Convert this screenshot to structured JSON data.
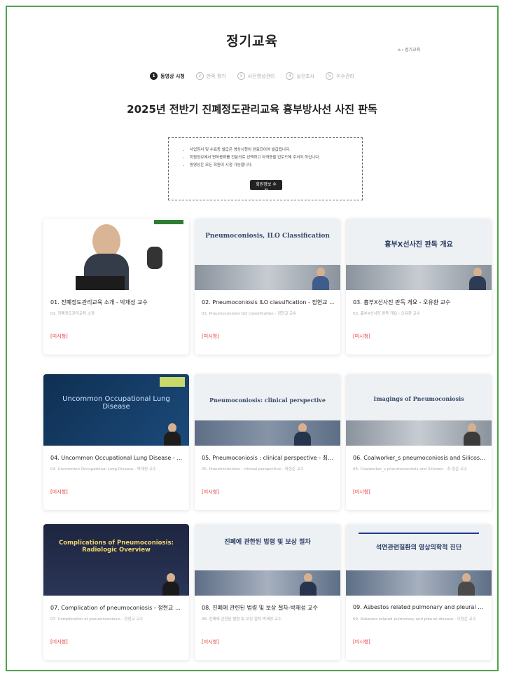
{
  "page": {
    "title": "정기교육",
    "breadcrumb": "⌂ › 정기교육"
  },
  "steps": [
    {
      "num": "1",
      "label": "동영상 시청",
      "active": true
    },
    {
      "num": "2",
      "label": "만족 평가",
      "active": false
    },
    {
      "num": "3",
      "label": "사전영상관리",
      "active": false
    },
    {
      "num": "4",
      "label": "실전조사",
      "active": false
    },
    {
      "num": "5",
      "label": "이수관리",
      "active": false
    }
  ],
  "course_title": "2025년 전반기 진폐정도관리교육 흉부방사선 사진 판독",
  "notice": {
    "items": [
      "사업장서 및 수료증 발급은 영상시청이 완료되어야 발급됩니다.",
      "회원정보에서 면허종류를 전문의로 선택하고 자격증을 업로드해 주셔야 하십니다.",
      "동영상은 모든 회원이 시청 가능합니다."
    ],
    "button": "회원정보 수정"
  },
  "colors": {
    "frame": "#4ea24a",
    "status": "#e53935"
  },
  "cards": [
    {
      "title": "01. 진폐정도관리교육 소개 - 박재성 교수",
      "sub": "01. 진폐정도관리교육 소개",
      "status": "[미시청]",
      "slide": ""
    },
    {
      "title": "02. Pneumoconiosis ILO classification - 정현교 교수",
      "sub": "02. Pneumoconiosis ILO classification - 정현교 교수",
      "status": "[미시청]",
      "slide": "Pneumoconiosis, ILO Classification"
    },
    {
      "title": "03. 흉부X선사진 판독 개요 - 오유환 교수",
      "sub": "03. 흉부X선사진 판독 개요 - 오유환 교수",
      "status": "[미시청]",
      "slide": "흉부X선사진 판독 개요"
    },
    {
      "title": "04. Uncommon Occupational Lung Disease - 박재성 교수",
      "sub": "04. Uncommon Occupational Lung Disease - 박재성 교수",
      "status": "[미시청]",
      "slide": "Uncommon Occupational Lung Disease"
    },
    {
      "title": "05. Pneumoconiosis : clinical perspective - 최현준 교수",
      "sub": "05. Pneumoconiosis : clinical perspective - 최현준 교수",
      "status": "[미시청]",
      "slide": "Pneumoconiosis: clinical perspective"
    },
    {
      "title": "06. Coalworker_s pneumoconiosis and Silicosis - 최 현준 교수",
      "sub": "06. Coalworker_s pneumoconiosis and Silicosis - 최 현준 교수",
      "status": "[미시청]",
      "slide": "Imagings of Pneumoconiosis"
    },
    {
      "title": "07. Complication of pneumoconiosis - 정현교 교수",
      "sub": "07. Complication of pneumoconiosis - 정현교 교수",
      "status": "[미시청]",
      "slide": "Complications of Pneumoconiosis: Radiologic Overview"
    },
    {
      "title": "08. 진폐에 관련된 법령 및 보상 절차-박재성 교수",
      "sub": "08. 진폐에 관련된 법령 및 보상 절차-박재성 교수",
      "status": "[미시청]",
      "slide": "진폐에 관한된 법령 및 보상 절차"
    },
    {
      "title": "09. Asbestos related pulmonary and pleural disease",
      "sub": "09. Asbestos related pulmonary and pleural disease - 이정은 교수",
      "status": "[미시청]",
      "slide": "석면관련질환의 영상의학적 진단"
    }
  ]
}
